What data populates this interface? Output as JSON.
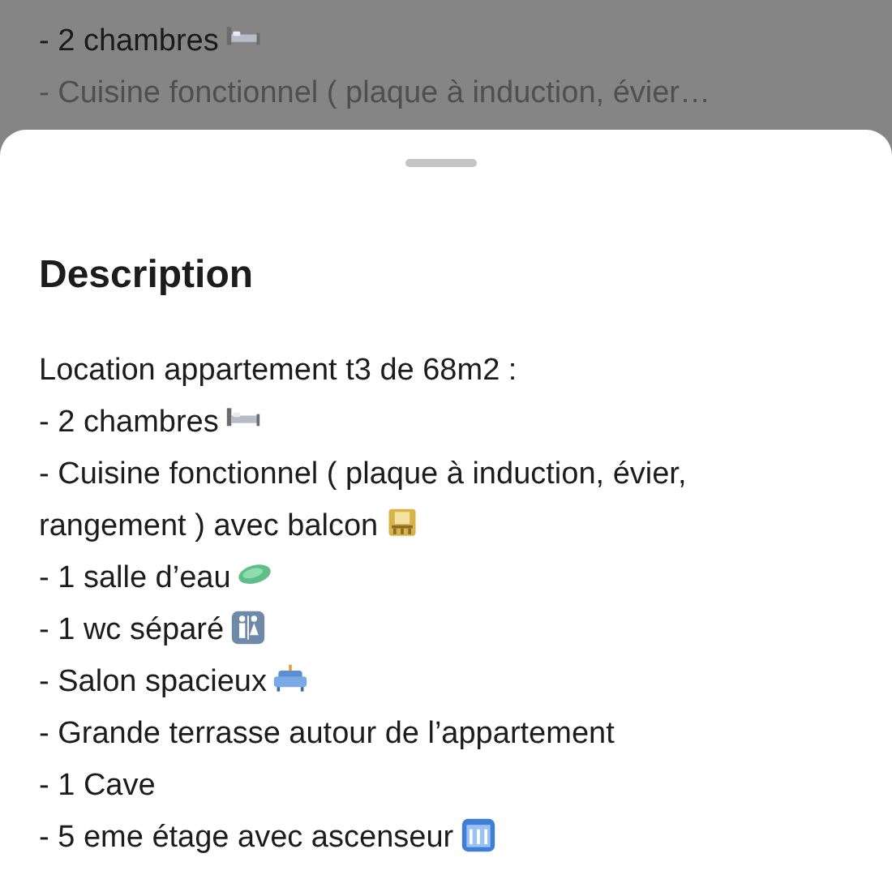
{
  "background": {
    "lines": [
      {
        "text": "- 2 chambres",
        "kind": "bed",
        "faded": false
      },
      {
        "text": "- Cuisine fonctionnel ( plaque à induction, évier…",
        "faded": true
      }
    ]
  },
  "sheet": {
    "title": "Description",
    "lines": [
      {
        "text": "Location appartement t3 de 68m2 :"
      },
      {
        "text": "- 2 chambres",
        "kind": "bed"
      },
      {
        "text": "- Cuisine fonctionnel ( plaque à induction, évier,"
      },
      {
        "text": "rangement ) avec balcon",
        "kind": "balcony"
      },
      {
        "text": "- 1 salle d’eau",
        "kind": "soap"
      },
      {
        "text": "- 1 wc séparé",
        "kind": "restroom"
      },
      {
        "text": "- Salon spacieux",
        "kind": "couch"
      },
      {
        "text": "- Grande terrasse autour de l’appartement"
      },
      {
        "text": "- 1 Cave"
      },
      {
        "text": "- 5 eme étage avec ascenseur",
        "kind": "elevator"
      }
    ]
  }
}
